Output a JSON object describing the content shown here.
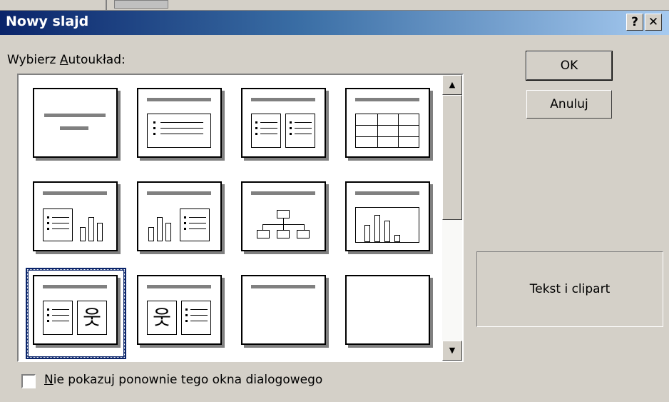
{
  "dialog": {
    "title": "Nowy slajd",
    "help_label": "?",
    "close_label": "✕"
  },
  "layout_picker": {
    "label_prefix": "Wybierz ",
    "label_underlined": "A",
    "label_suffix": "utoukład:",
    "selected": "Tekst i clipart"
  },
  "buttons": {
    "ok": "OK",
    "cancel": "Anuluj"
  },
  "preview": {
    "text": "Tekst i clipart"
  },
  "checkbox": {
    "underlined": "N",
    "label": "ie pokazuj ponownie tego okna dialogowego",
    "checked": false
  },
  "scrollbar": {
    "up_arrow": "▲",
    "down_arrow": "▼"
  }
}
